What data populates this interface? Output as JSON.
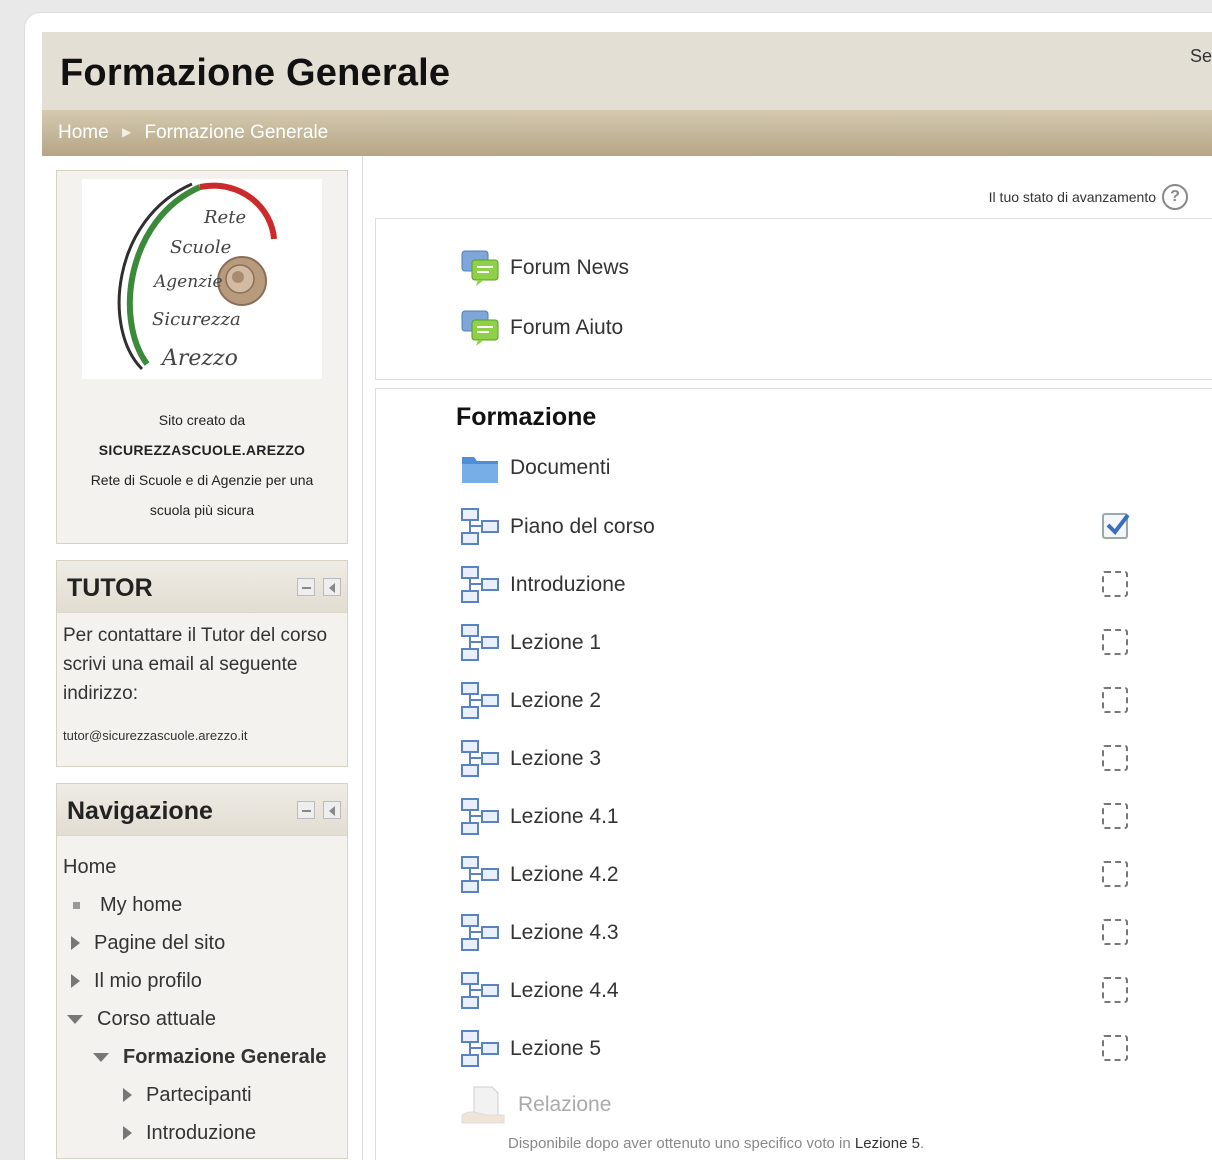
{
  "header": {
    "title": "Formazione Generale",
    "corner_text": "Se"
  },
  "breadcrumb": {
    "home": "Home",
    "current": "Formazione Generale"
  },
  "logo": {
    "lines": [
      "Rete",
      "Scuole",
      "Agenzie",
      "Sicurezza",
      "Arezzo"
    ]
  },
  "credit": {
    "line1": "Sito creato da",
    "line2": "SICUREZZASCUOLE.AREZZO",
    "line3": "Rete di Scuole e di Agenzie per una",
    "line4": "scuola più sicura"
  },
  "tutor": {
    "title": "TUTOR",
    "text": "Per contattare il Tutor del corso scrivi una email al seguente indirizzo:",
    "email": "tutor@sicurezzascuole.arezzo.it"
  },
  "navigation": {
    "title": "Navigazione",
    "home": "Home",
    "my_home": "My home",
    "site_pages": "Pagine del sito",
    "my_profile": "Il mio profilo",
    "current_course": "Corso attuale",
    "course": "Formazione Generale",
    "participants": "Partecipanti",
    "introduction": "Introduzione"
  },
  "progress": {
    "label": "Il tuo stato di avanzamento",
    "help": "?"
  },
  "section0": {
    "items": [
      "Forum News",
      "Forum Aiuto"
    ]
  },
  "section1": {
    "title": "Formazione",
    "folder": "Documenti",
    "items": [
      {
        "label": "Piano del corso",
        "done": true
      },
      {
        "label": "Introduzione",
        "done": false
      },
      {
        "label": "Lezione 1",
        "done": false
      },
      {
        "label": "Lezione 2",
        "done": false
      },
      {
        "label": "Lezione 3",
        "done": false
      },
      {
        "label": "Lezione 4.1",
        "done": false
      },
      {
        "label": "Lezione 4.2",
        "done": false
      },
      {
        "label": "Lezione 4.3",
        "done": false
      },
      {
        "label": "Lezione 4.4",
        "done": false
      },
      {
        "label": "Lezione 5",
        "done": false
      }
    ],
    "locked_activity": "Relazione",
    "availability_prefix": "Disponibile dopo aver ottenuto uno specifico voto in",
    "availability_link": "Lezione 5",
    "availability_suffix": "."
  },
  "colors": {
    "header_bg": "#e3dfd5",
    "navbar_bg": "#b6a686",
    "forum_icon": "#6dbf3b",
    "folder_icon": "#5b9bd5"
  }
}
